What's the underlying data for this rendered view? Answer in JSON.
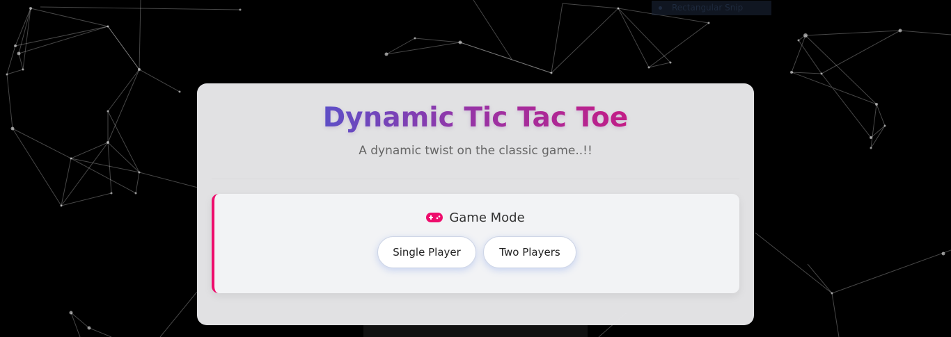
{
  "overlay": {
    "snip_label": "Rectangular Snip"
  },
  "header": {
    "title": "Dynamic Tic Tac Toe",
    "subtitle": "A dynamic twist on the classic game..!!"
  },
  "game_mode": {
    "icon": "gamepad-icon",
    "label": "Game Mode",
    "options": [
      {
        "label": "Single Player"
      },
      {
        "label": "Two Players"
      }
    ]
  },
  "colors": {
    "accent_pink": "#ee0c6c",
    "title_gradient_start": "#5b52cc",
    "title_gradient_end": "#cc1a84",
    "background": "#000000"
  }
}
